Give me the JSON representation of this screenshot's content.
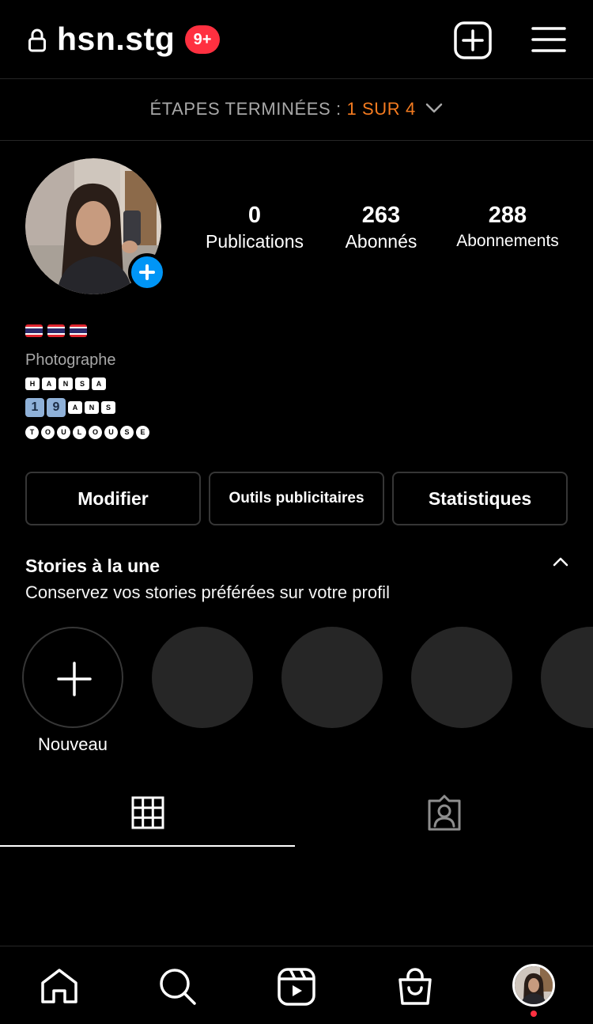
{
  "header": {
    "username": "hsn.stg",
    "notification_badge": "9+",
    "lock_icon": "lock-icon",
    "new_post_icon": "plus-square-icon",
    "menu_icon": "hamburger-menu-icon"
  },
  "steps": {
    "label": "ÉTAPES TERMINÉES : ",
    "value": "1 SUR 4",
    "icon": "chevron-down-icon"
  },
  "stats": {
    "posts": {
      "value": "0",
      "label": "Publications"
    },
    "followers": {
      "value": "263",
      "label": "Abonnés"
    },
    "following": {
      "value": "288",
      "label": "Abonnements"
    }
  },
  "bio": {
    "flags": [
      "🇹🇭",
      "🇹🇭",
      "🇹🇭"
    ],
    "category": "Photographe",
    "line1": [
      "H",
      "A",
      "N",
      "S",
      "A"
    ],
    "line2_numbers": [
      "1",
      "9"
    ],
    "line2_letters": [
      "A",
      "N",
      "S"
    ],
    "line3": [
      "T",
      "O",
      "U",
      "L",
      "O",
      "U",
      "S",
      "E"
    ]
  },
  "buttons": {
    "edit": "Modifier",
    "ads": "Outils publicitaires",
    "stats": "Statistiques"
  },
  "highlights": {
    "title": "Stories à la une",
    "subtitle": "Conservez vos stories préférées sur votre profil",
    "new_label": "Nouveau"
  },
  "tabs": {
    "grid_icon": "grid-icon",
    "tagged_icon": "tagged-person-icon"
  },
  "bottom_nav": {
    "items": [
      "home-icon",
      "search-icon",
      "reels-icon",
      "shop-icon",
      "profile-avatar"
    ]
  },
  "colors": {
    "background": "#000000",
    "accent_blue": "#0095f6",
    "badge_red": "#ff3040",
    "steps_orange": "#f47b20",
    "divider": "#262626"
  }
}
